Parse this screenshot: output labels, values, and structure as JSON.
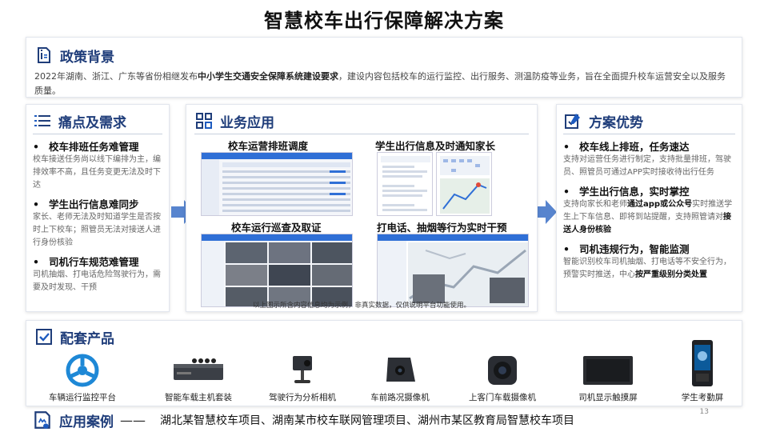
{
  "title": "智慧校车出行保障解决方案",
  "policy": {
    "heading": "政策背景",
    "text_pre": "2022年湖南、浙江、广东等省份相继发布",
    "text_bold": "中小学生交通安全保障系统建设要求",
    "text_post": "，建设内容包括校车的运行监控、出行服务、测温防疫等业务，旨在全面提升校车运营安全以及服务质量。"
  },
  "pain": {
    "heading": "痛点及需求",
    "items": [
      {
        "title": "校车排班任务难管理",
        "desc": "校车接送任务尚以线下编排为主，编排效率不高，且任务变更无法及时下达"
      },
      {
        "title": "学生出行信息难同步",
        "desc": "家长、老师无法及时知道学生是否按时上下校车；照管员无法对接送人进行身份核验"
      },
      {
        "title": "司机行车规范难管理",
        "desc": "司机抽烟、打电话危险驾驶行为，需要及时发现、干预"
      }
    ]
  },
  "apps": {
    "heading": "业务应用",
    "captions": [
      "校车运营排班调度",
      "学生出行信息及时通知家长",
      "校车运行巡查及取证",
      "打电话、抽烟等行为实时干预"
    ],
    "note": "以上图示所含内容信息均为示例，非真实数据，仅供说明平台功能使用。"
  },
  "adv": {
    "heading": "方案优势",
    "items": [
      {
        "title": "校车线上排班，任务速达",
        "desc_parts": [
          {
            "t": "支持对运营任务进行制定，支持批量排班，驾驶员、照管员可通过APP实时接收待出行任务",
            "b": false
          }
        ]
      },
      {
        "title": "学生出行信息，实时掌控",
        "desc_parts": [
          {
            "t": "支持向家长和老师",
            "b": false
          },
          {
            "t": "通过app或公众号",
            "b": true
          },
          {
            "t": "实时推送学生上下车信息、即将到站提醒，支持照管请对",
            "b": false
          },
          {
            "t": "接送人身份核验",
            "b": true
          }
        ]
      },
      {
        "title": "司机违规行为，智能监测",
        "desc_parts": [
          {
            "t": "智能识别校车司机抽烟、打电话等不安全行为，预警实时推送，中心",
            "b": false
          },
          {
            "t": "按严重级别分类处置",
            "b": true
          }
        ]
      }
    ]
  },
  "products": {
    "heading": "配套产品",
    "items": [
      {
        "label": "车辆运行监控平台",
        "icon": "platform-logo-icon"
      },
      {
        "label": "智能车载主机套装",
        "icon": "dvr-host-icon"
      },
      {
        "label": "驾驶行为分析相机",
        "icon": "driver-camera-icon"
      },
      {
        "label": "车前路况摄像机",
        "icon": "dash-camera-icon"
      },
      {
        "label": "上客门车载摄像机",
        "icon": "door-camera-icon"
      },
      {
        "label": "司机显示触摸屏",
        "icon": "touch-screen-icon"
      },
      {
        "label": "学生考勤屏",
        "icon": "attendance-screen-icon"
      }
    ]
  },
  "cases": {
    "heading": "应用案例",
    "dash": "——",
    "text": "湖北某智慧校车项目、湖南某市校车联网管理项目、湖州市某区教育局智慧校车项目"
  },
  "page_number": "13",
  "colors": {
    "heading": "#1f3d7a",
    "accent": "#1e5bbf",
    "arrow": "#3a6fc6"
  }
}
